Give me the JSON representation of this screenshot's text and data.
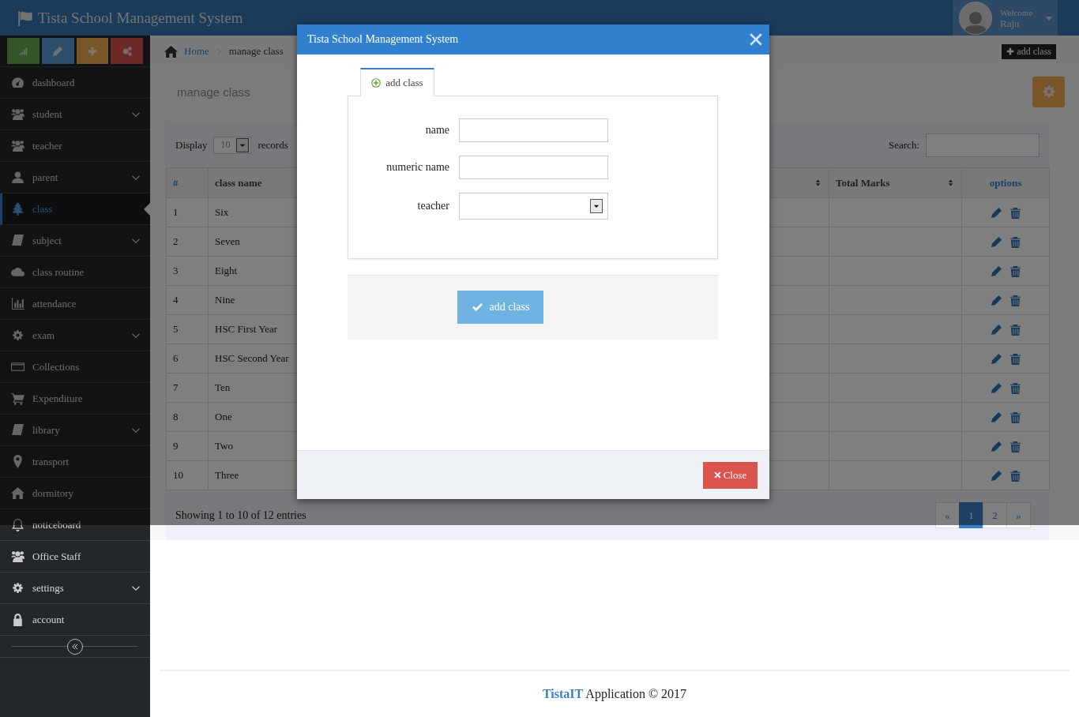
{
  "header": {
    "title": "Tista School Management System",
    "user": {
      "greeting": "Welcome",
      "name": "Raju"
    }
  },
  "sidebar": {
    "items": [
      {
        "label": "dashboard",
        "expandable": false,
        "selected": false
      },
      {
        "label": "student",
        "expandable": true,
        "selected": false
      },
      {
        "label": "teacher",
        "expandable": false,
        "selected": false
      },
      {
        "label": "parent",
        "expandable": true,
        "selected": false
      },
      {
        "label": "class",
        "expandable": false,
        "selected": true
      },
      {
        "label": "subject",
        "expandable": true,
        "selected": false
      },
      {
        "label": "class routine",
        "expandable": false,
        "selected": false
      },
      {
        "label": "attendance",
        "expandable": false,
        "selected": false
      },
      {
        "label": "exam",
        "expandable": true,
        "selected": false
      },
      {
        "label": "Collections",
        "expandable": false,
        "selected": false
      },
      {
        "label": "Expenditure",
        "expandable": false,
        "selected": false
      },
      {
        "label": "library",
        "expandable": true,
        "selected": false
      },
      {
        "label": "transport",
        "expandable": false,
        "selected": false
      },
      {
        "label": "dormitory",
        "expandable": false,
        "selected": false
      },
      {
        "label": "noticeboard",
        "expandable": false,
        "selected": false
      },
      {
        "label": "Office Staff",
        "expandable": false,
        "selected": false
      },
      {
        "label": "settings",
        "expandable": true,
        "selected": false
      },
      {
        "label": "account",
        "expandable": false,
        "selected": false
      }
    ]
  },
  "breadcrumb": {
    "home": "Home",
    "current": "manage class"
  },
  "add_button": "add class",
  "page_title": "manage class",
  "table_panel": {
    "display_label": "Display",
    "page_size": "10",
    "records_label": "records",
    "search_label": "Search:",
    "columns": [
      {
        "label": "#",
        "sortable": false
      },
      {
        "label": "class name"
      },
      {
        "sortable": true
      },
      {
        "label": "Total Marks",
        "sortable": true
      },
      {
        "label": "options",
        "sortable": false
      }
    ],
    "rows": [
      {
        "number": "1",
        "class_name": "Six"
      },
      {
        "number": "2",
        "class_name": "Seven"
      },
      {
        "number": "3",
        "class_name": "Eight"
      },
      {
        "number": "4",
        "class_name": "Nine"
      },
      {
        "number": "5",
        "class_name": "HSC First Year"
      },
      {
        "number": "6",
        "class_name": "HSC Second Year"
      },
      {
        "number": "7",
        "class_name": "Ten"
      },
      {
        "number": "8",
        "class_name": "One"
      },
      {
        "number": "9",
        "class_name": "Two"
      },
      {
        "number": "10",
        "class_name": "Three"
      }
    ],
    "info": "Showing 1 to 10 of 12 entries",
    "pagination": [
      {
        "label": "«",
        "selected": false
      },
      {
        "label": "1",
        "selected": true
      },
      {
        "label": "2",
        "selected": false
      },
      {
        "label": "»",
        "selected": false
      }
    ]
  },
  "modal": {
    "title": "Tista School Management System",
    "tab": {
      "label": "add class",
      "selected": true
    },
    "fields": [
      {
        "label": "name",
        "kind": "text"
      },
      {
        "label": "numeric name",
        "kind": "text"
      },
      {
        "label": "teacher",
        "kind": "select"
      }
    ],
    "submit": "add class",
    "close": "Close"
  },
  "footer": "**TistaIT** Application © 2017"
}
